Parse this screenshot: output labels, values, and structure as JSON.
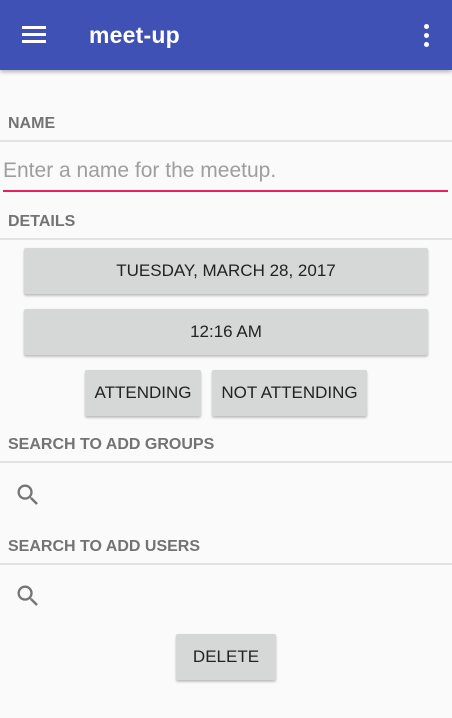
{
  "app_bar": {
    "title": "meet-up",
    "menu_icon": "hamburger-menu-icon",
    "overflow_icon": "more-vert-icon",
    "color": "#3f51b5"
  },
  "name_section": {
    "label": "NAME",
    "placeholder": "Enter a name for the meetup.",
    "value": "",
    "underline_color": "#e91e63"
  },
  "details_section": {
    "label": "DETAILS",
    "date_button": "TUESDAY, MARCH 28, 2017",
    "time_button": "12:16 AM",
    "attending_button": "ATTENDING",
    "not_attending_button": "NOT ATTENDING"
  },
  "groups_section": {
    "label": "SEARCH TO ADD GROUPS",
    "search_icon": "search-icon"
  },
  "users_section": {
    "label": "SEARCH TO ADD USERS",
    "search_icon": "search-icon"
  },
  "delete_button": "DELETE"
}
